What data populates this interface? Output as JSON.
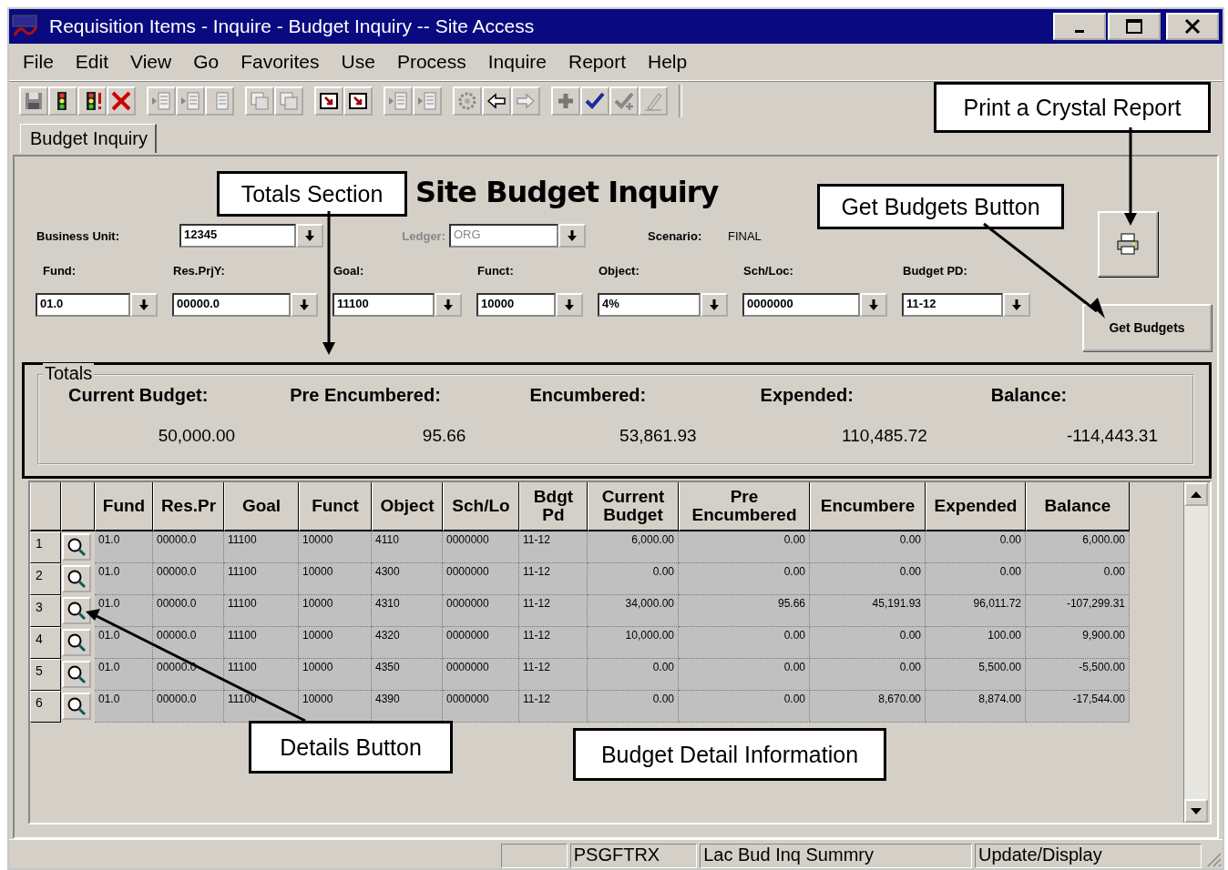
{
  "window": {
    "title": "Requisition Items - Inquire - Budget Inquiry -- Site Access"
  },
  "menu": [
    {
      "label": "File"
    },
    {
      "label": "Edit"
    },
    {
      "label": "View"
    },
    {
      "label": "Go"
    },
    {
      "label": "Favorites"
    },
    {
      "label": "Use"
    },
    {
      "label": "Process"
    },
    {
      "label": "Inquire"
    },
    {
      "label": "Report"
    },
    {
      "label": "Help"
    }
  ],
  "tabs": [
    {
      "label": "Budget Inquiry",
      "selected": true
    }
  ],
  "page_title": "Site Budget Inquiry",
  "header_fields": [
    {
      "kind": "dropdown",
      "label": "Business Unit:",
      "value": "12345",
      "disabled": false
    },
    {
      "kind": "dropdown",
      "label": "Ledger:",
      "value": "ORG",
      "disabled": true
    },
    {
      "kind": "display",
      "label": "Scenario:",
      "value": "FINAL"
    }
  ],
  "filter_fields": [
    {
      "label": "Fund:",
      "value": "01.0"
    },
    {
      "label": "Res.PrjY:",
      "value": "00000.0"
    },
    {
      "label": "Goal:",
      "value": "11100"
    },
    {
      "label": "Funct:",
      "value": "10000"
    },
    {
      "label": "Object:",
      "value": "4%"
    },
    {
      "label": "Sch/Loc:",
      "value": "0000000"
    },
    {
      "label": "Budget PD:",
      "value": "11-12"
    }
  ],
  "get_budgets_button": "Get Budgets",
  "totals": {
    "title": "Totals",
    "items": [
      {
        "label": "Current Budget:",
        "value": "50,000.00"
      },
      {
        "label": "Pre Encumbered:",
        "value": "95.66"
      },
      {
        "label": "Encumbered:",
        "value": "53,861.93"
      },
      {
        "label": "Expended:",
        "value": "110,485.72"
      },
      {
        "label": "Balance:",
        "value": "-114,443.31"
      }
    ]
  },
  "table": {
    "columns": [
      "Fund",
      "Res.Pr",
      "Goal",
      "Funct",
      "Object",
      "Sch/Lo",
      "Bdgt Pd",
      "Current Budget",
      "Pre Encumbered",
      "Encumbere",
      "Expended",
      "Balance"
    ],
    "rows": [
      {
        "number": "1",
        "cells": [
          "01.0",
          "00000.0",
          "11100",
          "10000",
          "4110",
          "0000000",
          "11-12",
          "6,000.00",
          "0.00",
          "0.00",
          "0.00",
          "6,000.00"
        ]
      },
      {
        "number": "2",
        "cells": [
          "01.0",
          "00000.0",
          "11100",
          "10000",
          "4300",
          "0000000",
          "11-12",
          "0.00",
          "0.00",
          "0.00",
          "0.00",
          "0.00"
        ]
      },
      {
        "number": "3",
        "cells": [
          "01.0",
          "00000.0",
          "11100",
          "10000",
          "4310",
          "0000000",
          "11-12",
          "34,000.00",
          "95.66",
          "45,191.93",
          "96,011.72",
          "-107,299.31"
        ]
      },
      {
        "number": "4",
        "cells": [
          "01.0",
          "00000.0",
          "11100",
          "10000",
          "4320",
          "0000000",
          "11-12",
          "10,000.00",
          "0.00",
          "0.00",
          "100.00",
          "9,900.00"
        ]
      },
      {
        "number": "5",
        "cells": [
          "01.0",
          "00000.0",
          "11100",
          "10000",
          "4350",
          "0000000",
          "11-12",
          "0.00",
          "0.00",
          "0.00",
          "5,500.00",
          "-5,500.00"
        ]
      },
      {
        "number": "6",
        "cells": [
          "01.0",
          "00000.0",
          "11100",
          "10000",
          "4390",
          "0000000",
          "11-12",
          "0.00",
          "0.00",
          "8,670.00",
          "8,874.00",
          "-17,544.00"
        ]
      }
    ]
  },
  "status_bar": [
    "PSGFTRX",
    "Lac Bud Inq Summry",
    "Update/Display"
  ],
  "annotations": [
    {
      "text": "Print a Crystal Report"
    },
    {
      "text": "Totals Section"
    },
    {
      "text": "Get Budgets Button"
    },
    {
      "text": "Details Button"
    },
    {
      "text": "Budget Detail Information"
    }
  ]
}
